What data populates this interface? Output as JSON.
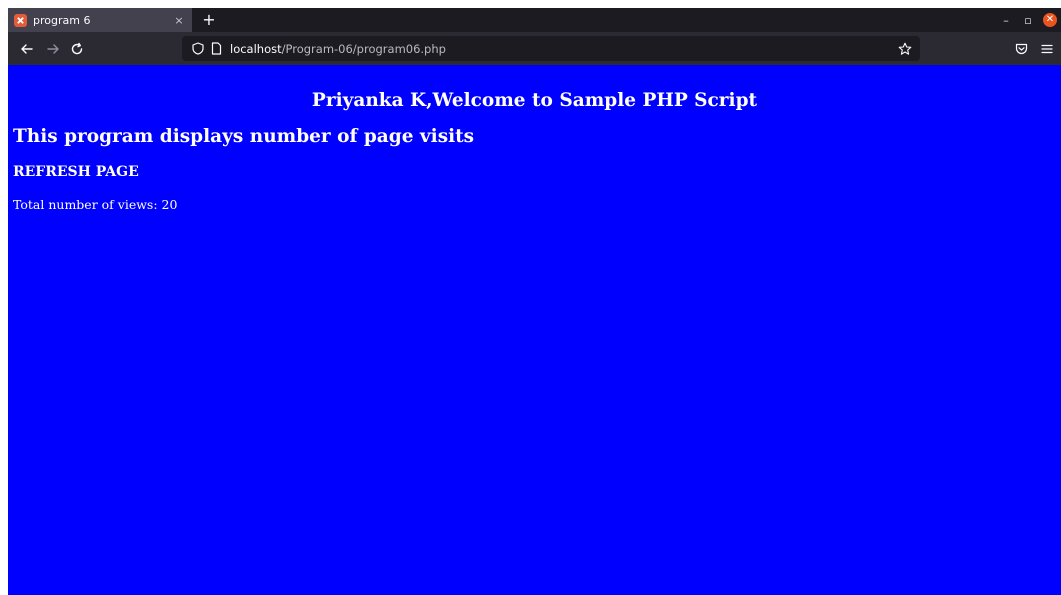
{
  "browser": {
    "tab": {
      "title": "program 6",
      "close_glyph": "×",
      "favicon": "xampp-icon"
    },
    "new_tab_glyph": "+",
    "window_controls": {
      "minimize": "–",
      "restore": "▫",
      "close": "✕"
    },
    "nav": {
      "back": "←",
      "forward": "→",
      "reload": "C"
    },
    "url": {
      "host": "localhost",
      "path": "/Program-06/program06.php"
    }
  },
  "page": {
    "welcome": "Priyanka K,Welcome to Sample PHP Script",
    "subtitle": "This program displays number of page visits",
    "refresh_link": "REFRESH PAGE",
    "views_label": "Total number of views: 20"
  },
  "colors": {
    "page_background": "#0000ff",
    "page_text": "#ffffff",
    "toolbar": "#2b2a33",
    "tabstrip": "#1c1b22",
    "close_button": "#e95420"
  }
}
